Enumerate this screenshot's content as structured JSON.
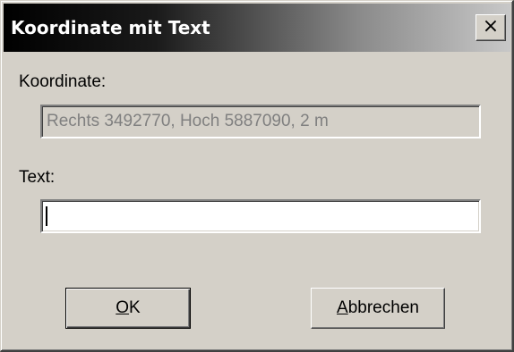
{
  "window": {
    "title": "Koordinate mit Text",
    "close_glyph": "×"
  },
  "form": {
    "coordinate_label": "Koordinate:",
    "coordinate_value": "Rechts 3492770, Hoch 5887090, 2 m",
    "text_label": "Text:",
    "text_value": ""
  },
  "buttons": {
    "ok_mnemonic": "O",
    "ok_rest": "K",
    "cancel_mnemonic": "A",
    "cancel_rest": "bbrechen"
  }
}
